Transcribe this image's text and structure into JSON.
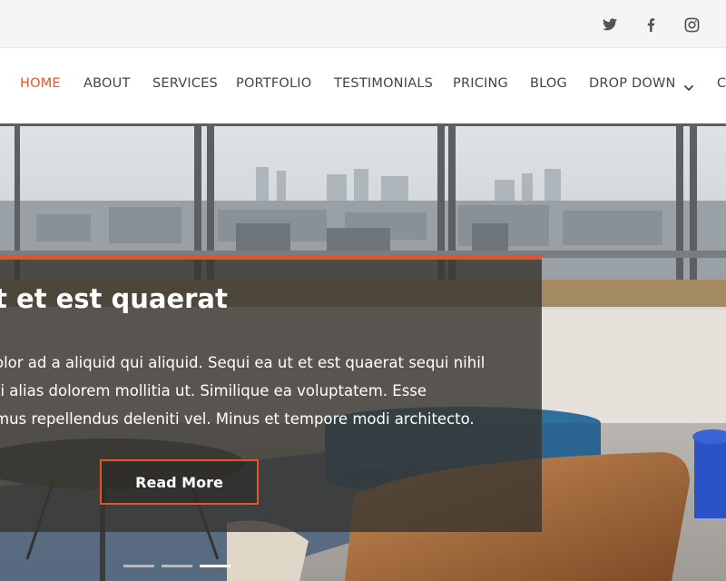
{
  "social": {
    "twitter_icon": "twitter-icon",
    "facebook_icon": "facebook-icon",
    "instagram_icon": "instagram-icon"
  },
  "nav": {
    "items": [
      {
        "label": "HOME",
        "active": true
      },
      {
        "label": "ABOUT"
      },
      {
        "label": "SERVICES"
      },
      {
        "label": "PORTFOLIO"
      },
      {
        "label": "TESTIMONIALS"
      },
      {
        "label": "PRICING"
      },
      {
        "label": "BLOG"
      },
      {
        "label": "DROP DOWN"
      },
      {
        "label": "C"
      }
    ],
    "caret_icon": "chevron-down-icon",
    "accent_color": "#e3542b"
  },
  "hero": {
    "title": "t et est quaerat",
    "lines": [
      "olor ad a aliquid qui aliquid. Sequi ea ut et est quaerat sequi nihil",
      "ti alias dolorem mollitia ut. Similique ea voluptatem. Esse",
      "mus repellendus deleniti vel. Minus et tempore modi architecto."
    ],
    "button_label": "Read More",
    "slides": 3,
    "active_slide": 3
  }
}
